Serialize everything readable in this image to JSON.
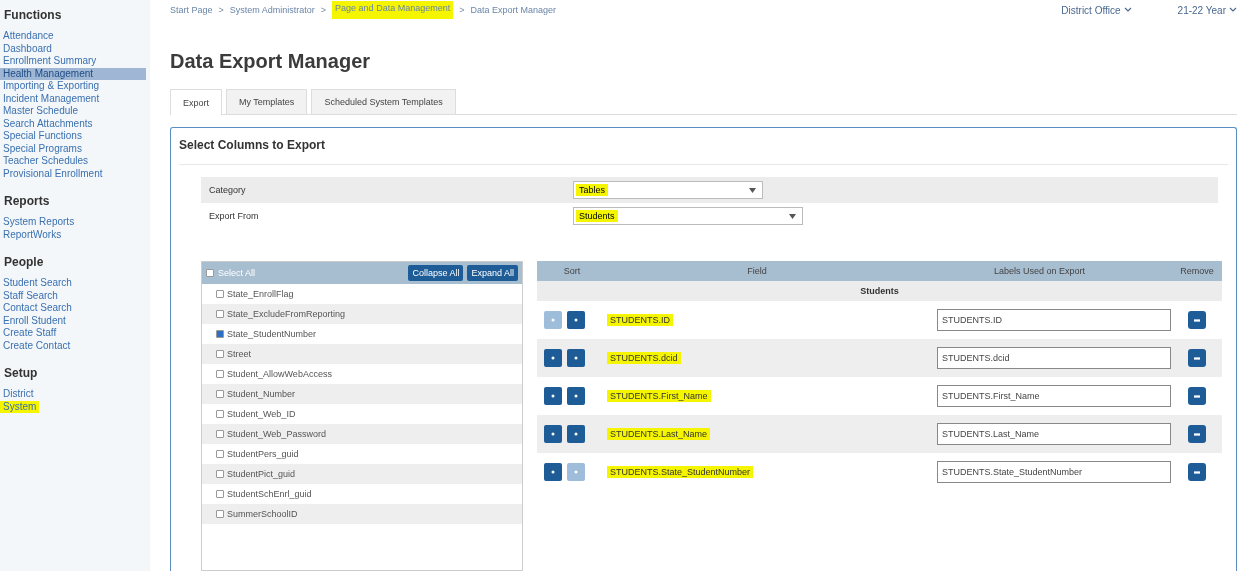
{
  "sidebar": {
    "sections": [
      {
        "title": "Functions",
        "items": [
          {
            "label": "Attendance",
            "selected": false,
            "highlighted": false
          },
          {
            "label": "Dashboard",
            "selected": false,
            "highlighted": false
          },
          {
            "label": "Enrollment Summary",
            "selected": false,
            "highlighted": false
          },
          {
            "label": "Health Management",
            "selected": true,
            "highlighted": false
          },
          {
            "label": "Importing & Exporting",
            "selected": false,
            "highlighted": false
          },
          {
            "label": "Incident Management",
            "selected": false,
            "highlighted": false
          },
          {
            "label": "Master Schedule",
            "selected": false,
            "highlighted": false
          },
          {
            "label": "Search Attachments",
            "selected": false,
            "highlighted": false
          },
          {
            "label": "Special Functions",
            "selected": false,
            "highlighted": false
          },
          {
            "label": "Special Programs",
            "selected": false,
            "highlighted": false
          },
          {
            "label": "Teacher Schedules",
            "selected": false,
            "highlighted": false
          },
          {
            "label": "Provisional Enrollment",
            "selected": false,
            "highlighted": false
          }
        ]
      },
      {
        "title": "Reports",
        "items": [
          {
            "label": "System Reports",
            "selected": false,
            "highlighted": false
          },
          {
            "label": "ReportWorks",
            "selected": false,
            "highlighted": false
          }
        ]
      },
      {
        "title": "People",
        "items": [
          {
            "label": "Student Search",
            "selected": false,
            "highlighted": false
          },
          {
            "label": "Staff Search",
            "selected": false,
            "highlighted": false
          },
          {
            "label": "Contact Search",
            "selected": false,
            "highlighted": false
          },
          {
            "label": "Enroll Student",
            "selected": false,
            "highlighted": false
          },
          {
            "label": "Create Staff",
            "selected": false,
            "highlighted": false
          },
          {
            "label": "Create Contact",
            "selected": false,
            "highlighted": false
          }
        ]
      },
      {
        "title": "Setup",
        "items": [
          {
            "label": "District",
            "selected": false,
            "highlighted": false
          },
          {
            "label": "System",
            "selected": false,
            "highlighted": true
          }
        ]
      }
    ]
  },
  "breadcrumb": [
    {
      "label": "Start Page",
      "highlighted": false
    },
    {
      "label": "System Administrator",
      "highlighted": false
    },
    {
      "label": "Page and Data Management",
      "highlighted": true
    },
    {
      "label": "Data Export Manager",
      "highlighted": false
    }
  ],
  "breadcrumb_separator": ">",
  "top_menus": [
    "District Office",
    "21-22 Year"
  ],
  "title": "Data Export Manager",
  "tabs": [
    {
      "label": "Export",
      "selected": true
    },
    {
      "label": "My Templates",
      "selected": false
    },
    {
      "label": "Scheduled System Templates",
      "selected": false
    }
  ],
  "panel": {
    "title": "Select Columns to Export",
    "filters": [
      {
        "label": "Category",
        "value": "Tables",
        "highlighted": true
      },
      {
        "label": "Export From",
        "value": "Students",
        "highlighted": true
      }
    ],
    "column_list": {
      "select_all": {
        "label": "Select All",
        "checked": false
      },
      "buttons": [
        "Collapse All",
        "Expand All"
      ],
      "items": [
        {
          "label": "State_EnrollFlag",
          "checked": false
        },
        {
          "label": "State_ExcludeFromReporting",
          "checked": false
        },
        {
          "label": "State_StudentNumber",
          "checked": true
        },
        {
          "label": "Street",
          "checked": false
        },
        {
          "label": "Student_AllowWebAccess",
          "checked": false
        },
        {
          "label": "Student_Number",
          "checked": false
        },
        {
          "label": "Student_Web_ID",
          "checked": false
        },
        {
          "label": "Student_Web_Password",
          "checked": false
        },
        {
          "label": "StudentPers_guid",
          "checked": false
        },
        {
          "label": "StudentPict_guid",
          "checked": false
        },
        {
          "label": "StudentSchEnrl_guid",
          "checked": false
        },
        {
          "label": "SummerSchoolID",
          "checked": false
        }
      ]
    },
    "export_table": {
      "columns": [
        "Sort",
        "Field",
        "Labels Used on Export",
        "Remove"
      ],
      "group": "Students",
      "rows": [
        {
          "field": "STUDENTS.ID",
          "label": "STUDENTS.ID",
          "up_disabled": true,
          "down_disabled": false,
          "highlighted": true
        },
        {
          "field": "STUDENTS.dcid",
          "label": "STUDENTS.dcid",
          "up_disabled": false,
          "down_disabled": false,
          "highlighted": true
        },
        {
          "field": "STUDENTS.First_Name",
          "label": "STUDENTS.First_Name",
          "up_disabled": false,
          "down_disabled": false,
          "highlighted": true
        },
        {
          "field": "STUDENTS.Last_Name",
          "label": "STUDENTS.Last_Name",
          "up_disabled": false,
          "down_disabled": false,
          "highlighted": true
        },
        {
          "field": "STUDENTS.State_StudentNumber",
          "label": "STUDENTS.State_StudentNumber",
          "up_disabled": false,
          "down_disabled": true,
          "highlighted": true
        }
      ]
    }
  }
}
